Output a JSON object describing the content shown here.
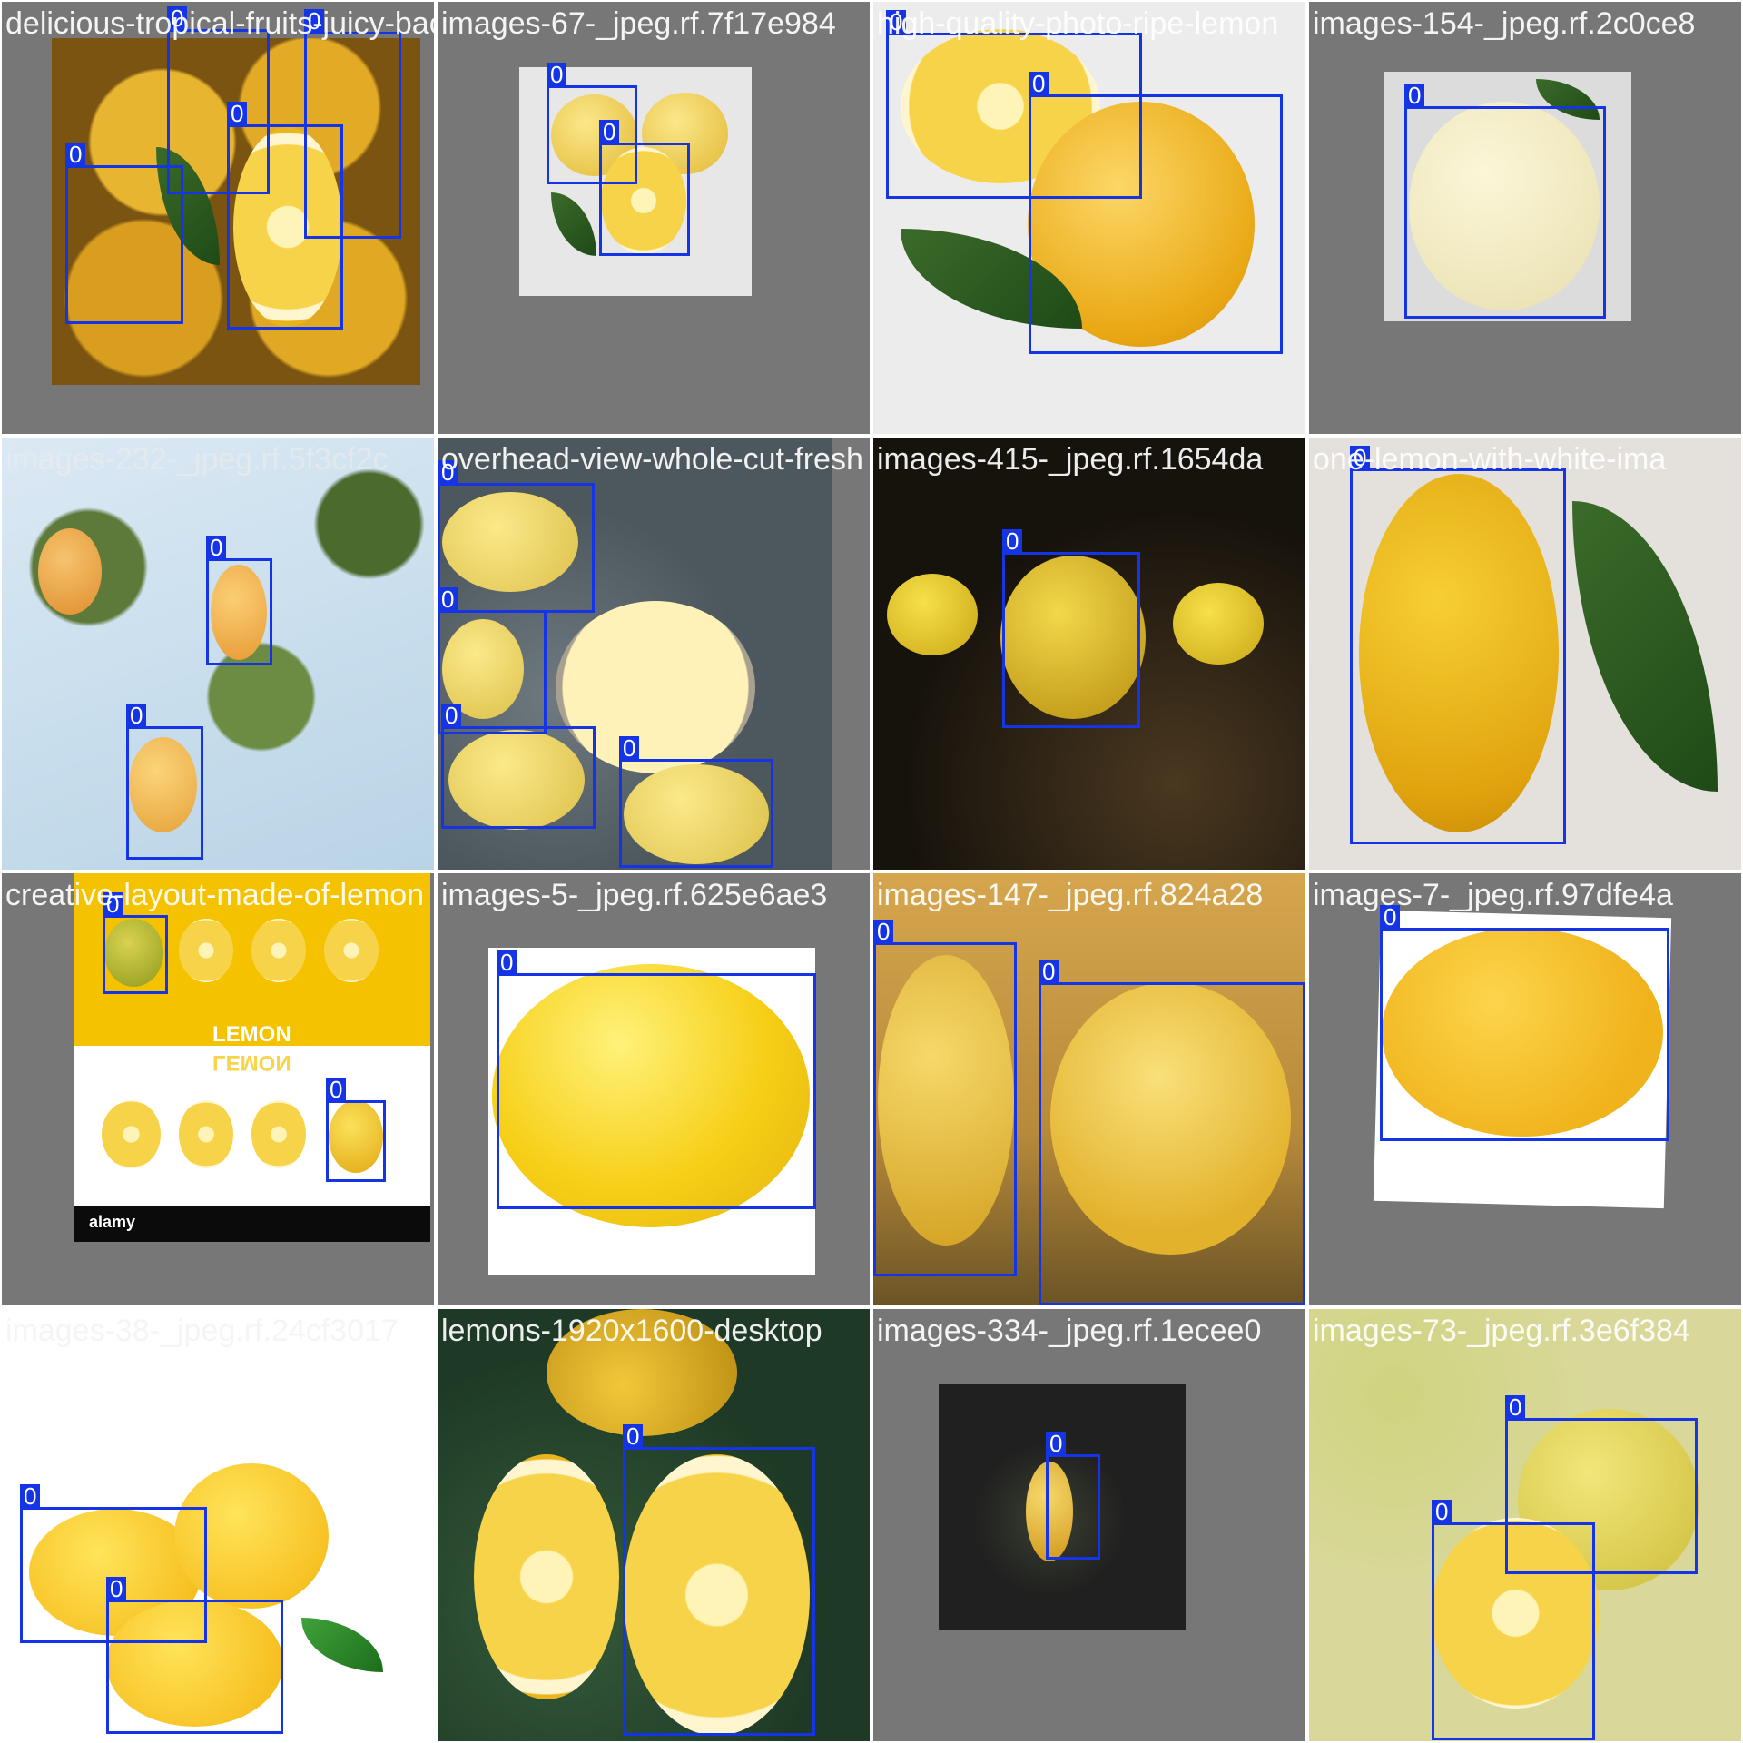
{
  "colors": {
    "box": "#1434e6",
    "label_bg": "#1434e6",
    "label_text": "#ffffff",
    "tile_gray": "#777777"
  },
  "tiles": [
    {
      "title": "delicious-tropical-fruits-juicy-backgro",
      "boxes": [
        "0",
        "0",
        "0",
        "0"
      ]
    },
    {
      "title": "images-67-_jpeg.rf.7f17e984",
      "boxes": [
        "0",
        "0"
      ]
    },
    {
      "title": "high-quality-photo-ripe-lemon",
      "boxes": [
        "0",
        "0"
      ]
    },
    {
      "title": "images-154-_jpeg.rf.2c0ce8",
      "boxes": [
        "0"
      ]
    },
    {
      "title": "images-232-_jpeg.rf.5f3cf2c",
      "boxes": [
        "0",
        "0"
      ]
    },
    {
      "title": "overhead-view-whole-cut-fresh",
      "boxes": [
        "0",
        "0",
        "0",
        "0"
      ]
    },
    {
      "title": "images-415-_jpeg.rf.1654da",
      "boxes": [
        "0"
      ]
    },
    {
      "title": "one-lemon-with-white-ima",
      "boxes": [
        "0"
      ]
    },
    {
      "title": "creative-layout-made-of-lemon",
      "boxes": [
        "0",
        "0"
      ],
      "poster_text": "LEMON",
      "poster_mirror": "LEMON",
      "watermark": "alamy"
    },
    {
      "title": "images-5-_jpeg.rf.625e6ae3",
      "boxes": [
        "0"
      ]
    },
    {
      "title": "images-147-_jpeg.rf.824a28",
      "boxes": [
        "0",
        "0"
      ]
    },
    {
      "title": "images-7-_jpeg.rf.97dfe4a",
      "boxes": [
        "0"
      ]
    },
    {
      "title": "images-38-_jpeg.rf.24cf3017",
      "boxes": [
        "0",
        "0"
      ]
    },
    {
      "title": "lemons-1920x1600-desktop",
      "boxes": [
        "0"
      ]
    },
    {
      "title": "images-334-_jpeg.rf.1ecee0",
      "boxes": [
        "0"
      ]
    },
    {
      "title": "images-73-_jpeg.rf.3e6f384",
      "boxes": [
        "0",
        "0"
      ]
    }
  ]
}
